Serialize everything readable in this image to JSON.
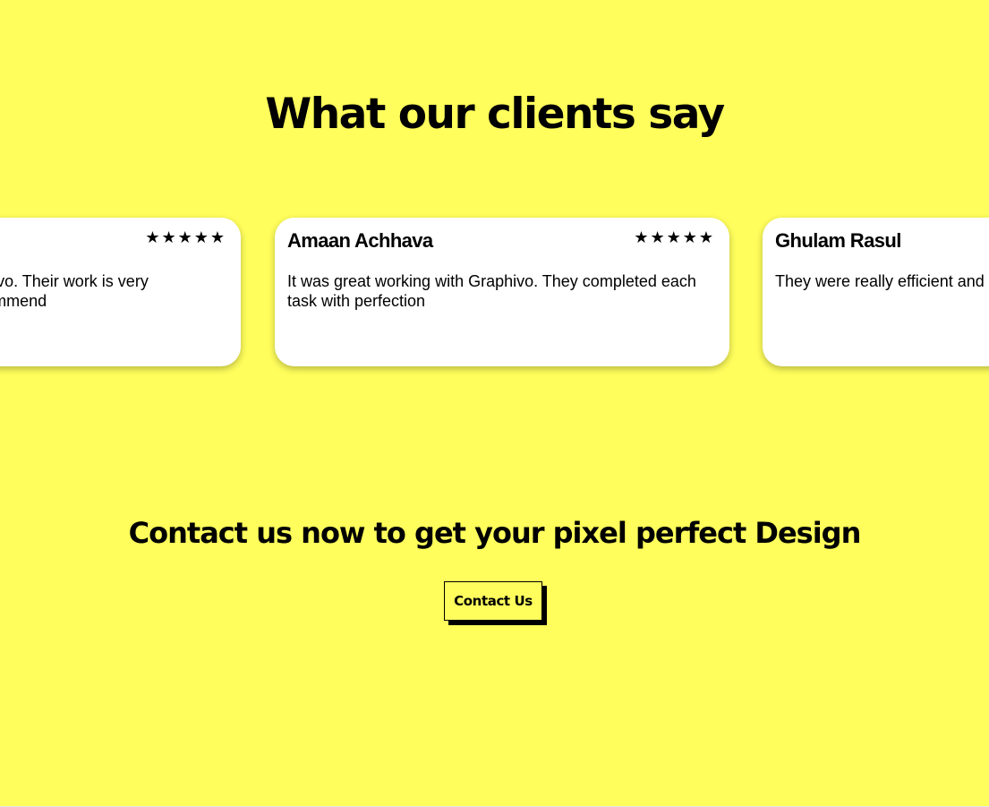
{
  "testimonials": {
    "title": "What our clients say",
    "cards": [
      {
        "name": "",
        "stars": "★★★★★",
        "text": "It was great working with Graphivo. Their work is very professional. Will definitely recommend"
      },
      {
        "name": "Amaan Achhava",
        "stars": "★★★★★",
        "text": "It was great working with Graphivo. They completed each task with perfection"
      },
      {
        "name": "Ghulam Rasul",
        "stars": "★★★★★",
        "text": "They were really efficient and paid attention to detail."
      }
    ]
  },
  "contact": {
    "title": "Contact us now to get your pixel perfect Design",
    "button_label": "Contact Us"
  },
  "colors": {
    "background": "#fffe5c",
    "card": "#ffffff",
    "text": "#000000"
  }
}
